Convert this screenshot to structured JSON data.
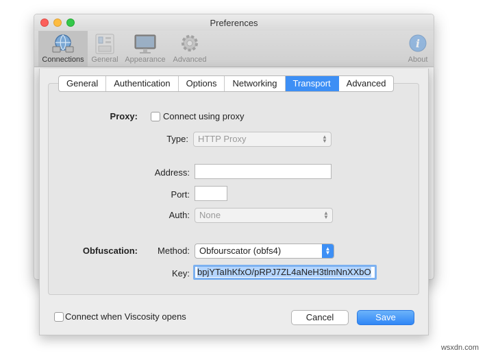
{
  "window": {
    "title": "Preferences"
  },
  "toolbar": {
    "items": [
      {
        "label": "Connections",
        "icon": "globe-network-icon",
        "selected": true
      },
      {
        "label": "General",
        "icon": "switch-panel-icon"
      },
      {
        "label": "Appearance",
        "icon": "display-monitor-icon"
      },
      {
        "label": "Advanced",
        "icon": "gear-icon"
      },
      {
        "label": "About",
        "icon": "info-icon"
      }
    ]
  },
  "tabs": [
    "General",
    "Authentication",
    "Options",
    "Networking",
    "Transport",
    "Advanced"
  ],
  "active_tab": "Transport",
  "proxy": {
    "section_label": "Proxy:",
    "checkbox_label": "Connect using proxy",
    "checked": false,
    "type_label": "Type:",
    "type_value": "HTTP Proxy",
    "address_label": "Address:",
    "address_value": "",
    "port_label": "Port:",
    "port_value": "",
    "auth_label": "Auth:",
    "auth_value": "None"
  },
  "obfuscation": {
    "section_label": "Obfuscation:",
    "method_label": "Method:",
    "method_value": "Obfourscator (obfs4)",
    "key_label": "Key:",
    "key_value": "bpjYTaIhKfxO/pRPJ7ZL4aNeH3tlmNnXXbO"
  },
  "footer": {
    "startup_checkbox_label": "Connect when Viscosity opens",
    "startup_checked": false,
    "cancel_label": "Cancel",
    "save_label": "Save"
  },
  "watermark": "wsxdn.com",
  "colors": {
    "accent": "#3d8ff5",
    "window_bg": "#ececec"
  }
}
